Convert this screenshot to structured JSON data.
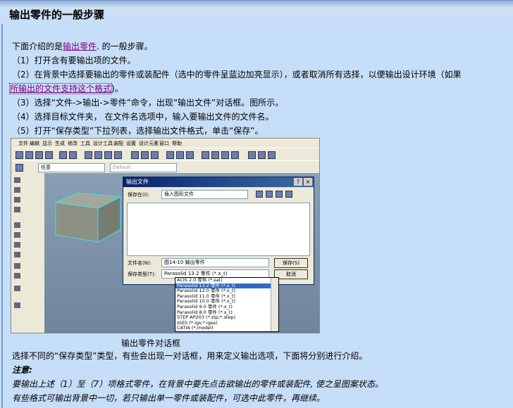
{
  "page": {
    "title": "输出零件的一般步骤",
    "intro_prefix": "下面介绍的是",
    "intro_link": "输出零件",
    "intro_suffix": ". 的一般步骤。",
    "step1": "（1）打开含有要输出项的文件。",
    "step2_a": "（2）在背景中选择要输出的零件或装配件（选中的零件呈蓝边加亮显示），或者取消所有选择，以便输出设计环境（如果",
    "step2_b_link": "所输出的文件支持这个格式",
    "step2_b_suffix": ")。",
    "step3": "（3）选择“文件->输出->零件”命令，出现“输出文件”对话框。图所示。",
    "step4": "（4）选择目标文件夹，  在文件名选项中，输入要输出文件的文件名。",
    "step5": "（5）打开“保存类型”下拉列表，选择输出文件格式，单击“保存”。",
    "caption": "输出零件对话框",
    "after": "选择不同的“保存类型”类型，有些会出现一对话框，用来定义输出选项，下面将分别进行介绍。",
    "note_title": "注意:",
    "note1": "要输出上述（1）至（7）项格式零件，在背景中要先点击欲输出的零件或装配件, 使之呈图案状态。",
    "note2": "有些格式可输出背景中一切，若只输出单一零件或装配件，可选中此零件，再继续。"
  },
  "app": {
    "menus": [
      "文件",
      "编辑",
      "显示",
      "生成",
      "修改",
      "工具",
      "设计工具",
      "装配",
      "设置",
      "设计元素",
      "窗口",
      "帮助"
    ],
    "filter_value": "任意",
    "default_value": "Default"
  },
  "dialog": {
    "title": "输出文件",
    "save_in_label": "保存在(I):",
    "save_in_value": "插入图形文件",
    "filename_label": "文件名(N):",
    "filename_value": "图14-10 输出零件",
    "type_label": "保存类型(T):",
    "type_value": "Parasolid 13.2 零件 (*.x_t)",
    "save_btn": "保存(S)",
    "cancel_btn": "取消",
    "help_icon": "?",
    "close_icon": "×",
    "type_options": [
      "ACIS 2.0 零件 (*.sat)",
      "Parasolid 13.2 零件 (*.x_t)",
      "Parasolid 12.0 零件 (*.x_t)",
      "Parasolid 11.0 零件 (*.x_t)",
      "Parasolid 10.0 零件 (*.x_t)",
      "Parasolid 9.0 零件 (*.x_t)",
      "Parasolid 8.0 零件 (*.x_t)",
      "STEP AP203 (*.stp;*.step)",
      "IGES (*.igs;*.iges)",
      "CATIA (*.model)"
    ]
  }
}
